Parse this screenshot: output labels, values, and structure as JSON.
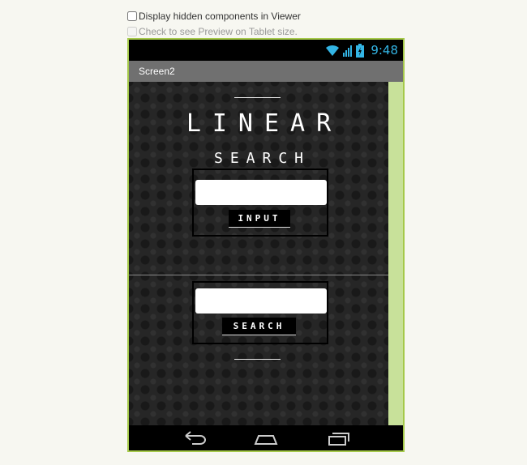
{
  "options": {
    "hidden_components_label": "Display hidden components in Viewer",
    "tablet_preview_label": "Check to see Preview on Tablet size."
  },
  "status_bar": {
    "time": "9:48",
    "icons": [
      "wifi-icon",
      "signal-icon",
      "battery-icon"
    ],
    "accent_color": "#33b5e5"
  },
  "title_bar": {
    "title": "Screen2"
  },
  "screen": {
    "heading_main": "LINEAR",
    "heading_sub": "SEARCH",
    "input_section": {
      "field_value": "",
      "button_label": "INPUT"
    },
    "search_section": {
      "field_value": "",
      "button_label": "SEARCH"
    }
  },
  "nav_bar": {
    "icons": [
      "back-icon",
      "home-icon",
      "recent-apps-icon"
    ]
  },
  "colors": {
    "device_border": "#a5c94a",
    "scroll_strip": "#c8e19a",
    "title_bar_bg": "#707070",
    "page_bg": "#f7f7f1"
  }
}
